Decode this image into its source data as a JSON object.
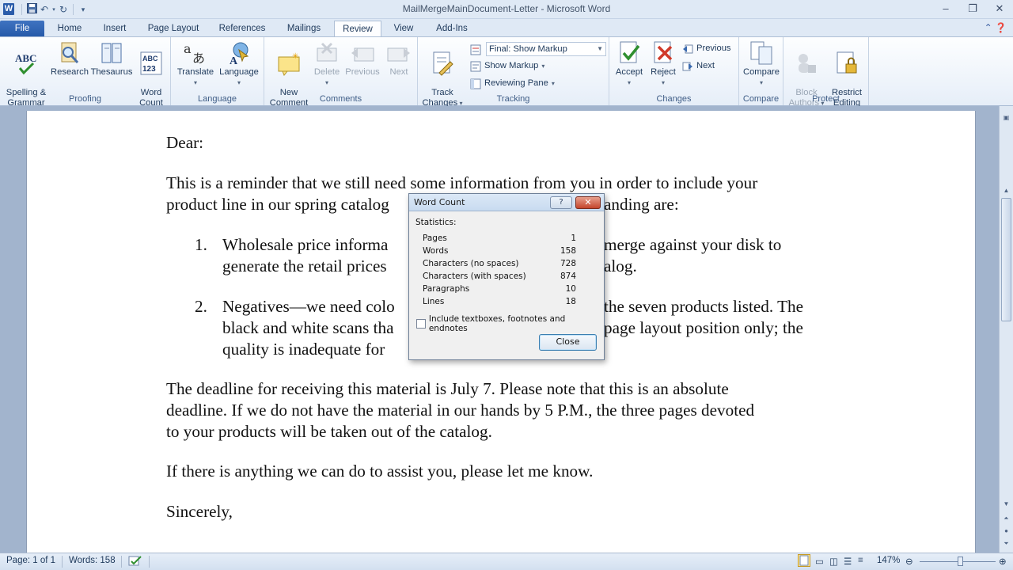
{
  "window": {
    "title": "MailMergeMainDocument-Letter  -  Microsoft Word",
    "app_icon": "W"
  },
  "tabs": [
    "File",
    "Home",
    "Insert",
    "Page Layout",
    "References",
    "Mailings",
    "Review",
    "View",
    "Add-Ins"
  ],
  "active_tab": "Review",
  "ribbon": {
    "proofing": {
      "label": "Proofing",
      "spelling": "Spelling &\nGrammar",
      "research": "Research",
      "thesaurus": "Thesaurus",
      "word_count": "Word\nCount"
    },
    "language": {
      "label": "Language",
      "translate": "Translate",
      "language": "Language"
    },
    "comments": {
      "label": "Comments",
      "new_comment": "New\nComment",
      "delete": "Delete",
      "previous": "Previous",
      "next": "Next"
    },
    "tracking": {
      "label": "Tracking",
      "track_changes": "Track\nChanges",
      "display_mode": "Final: Show Markup",
      "show_markup": "Show Markup",
      "reviewing_pane": "Reviewing Pane"
    },
    "changes": {
      "label": "Changes",
      "accept": "Accept",
      "reject": "Reject",
      "previous": "Previous",
      "next": "Next"
    },
    "compare": {
      "label": "Compare",
      "compare": "Compare"
    },
    "protect": {
      "label": "Protect",
      "block_authors": "Block\nAuthors",
      "restrict_editing": "Restrict\nEditing"
    }
  },
  "document": {
    "salutation": "Dear:",
    "para1_line1": "This is a reminder that we still need some information from you in order to include your",
    "para1_line2_a": "product line in our spring catalog",
    "para1_line2_b": "anding are:",
    "item1_num": "1.",
    "item1_line1_a": "Wholesale price informa",
    "item1_line1_b": "merge against your disk to",
    "item1_line2_a": "generate the retail prices",
    "item1_line2_b": "alog.",
    "item2_num": "2.",
    "item2_line1_a": "Negatives—we need colo",
    "item2_line1_b": "the seven products listed. The",
    "item2_line2_a": "black and white scans tha",
    "item2_line2_b": "page layout position only; the",
    "item2_line3_a": "quality is inadequate for",
    "para3_line1": "The deadline for receiving this material is July 7. Please note that this is an absolute",
    "para3_line2": "deadline. If we do not have the material in our hands by 5 P.M., the three pages devoted",
    "para3_line3": "to your products will be taken out of the catalog.",
    "para4": "If there is anything we can do to assist you, please let me know.",
    "closing": "Sincerely,"
  },
  "dialog": {
    "title": "Word Count",
    "help": "?",
    "statistics_label": "Statistics:",
    "rows": [
      {
        "label": "Pages",
        "value": "1"
      },
      {
        "label": "Words",
        "value": "158"
      },
      {
        "label": "Characters (no spaces)",
        "value": "728"
      },
      {
        "label": "Characters (with spaces)",
        "value": "874"
      },
      {
        "label": "Paragraphs",
        "value": "10"
      },
      {
        "label": "Lines",
        "value": "18"
      }
    ],
    "include_label": "Include textboxes, footnotes and endnotes",
    "include_checked": false,
    "close_label": "Close"
  },
  "status": {
    "page": "Page: 1 of 1",
    "words": "Words: 158",
    "zoom": "147%"
  }
}
